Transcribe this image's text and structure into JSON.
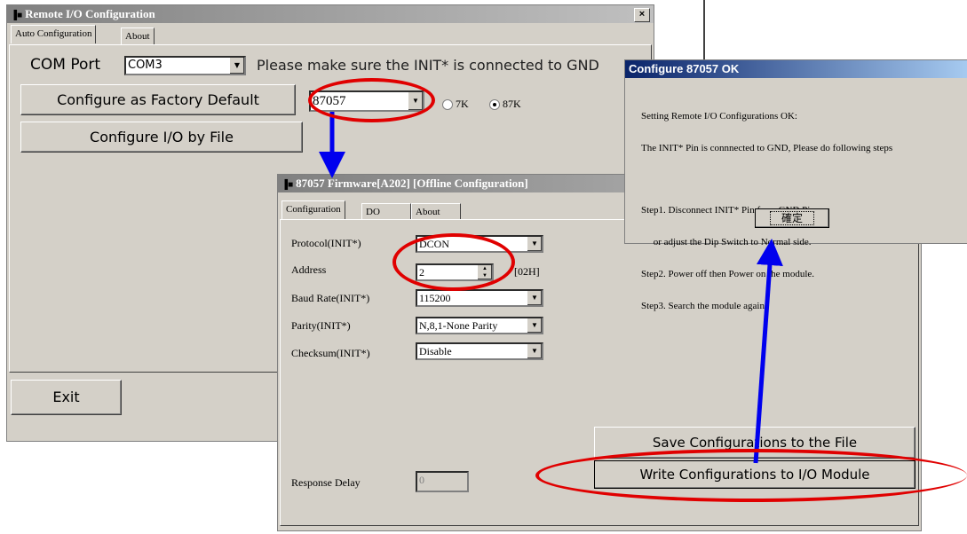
{
  "main_window": {
    "title": "Remote I/O Configuration",
    "close_glyph": "×",
    "tabs": [
      "Auto Configuration",
      "About"
    ],
    "com_port_label": "COM Port",
    "com_port_value": "COM3",
    "init_notice": "Please make sure the INIT* is connected to GND",
    "factory_default_button": "Configure as Factory Default",
    "module_value": "87057",
    "radio_7k": "7K",
    "radio_87k": "87K",
    "radio_selected": "87K",
    "configure_by_file_button": "Configure I/O by File",
    "exit_button": "Exit"
  },
  "firmware_window": {
    "title": "87057 Firmware[A202] [Offline Configuration]",
    "tabs": [
      "Configuration",
      "DO",
      "About"
    ],
    "fields": [
      {
        "label": "Protocol(INIT*)",
        "value": "DCON"
      },
      {
        "label": "Address",
        "value": "2",
        "hex": "[02H]"
      },
      {
        "label": "Baud Rate(INIT*)",
        "value": "115200"
      },
      {
        "label": "Parity(INIT*)",
        "value": "N,8,1-None Parity"
      },
      {
        "label": "Checksum(INIT*)",
        "value": "Disable"
      }
    ],
    "response_delay_label": "Response Delay",
    "response_delay_value": "0",
    "save_button": "Save Configurations to the File",
    "write_button": "Write Configurations to I/O Module"
  },
  "ok_dialog": {
    "title": "Configure 87057 OK",
    "lines": [
      "Setting Remote I/O Configurations OK:",
      "The INIT* Pin is connnected to GND, Please do following steps",
      "",
      "Step1. Disconnect INIT* Pin from GND Pin.",
      "     or adjust the Dip Switch to Normal side.",
      "Step2. Power off then Power on the module.",
      "Step3. Search the module again."
    ],
    "ok_button": "確定"
  },
  "colors": {
    "annotation_red": "#e00000",
    "annotation_blue": "#0000ee",
    "window_face": "#d4d0c8",
    "active_title": "#0a246a"
  }
}
